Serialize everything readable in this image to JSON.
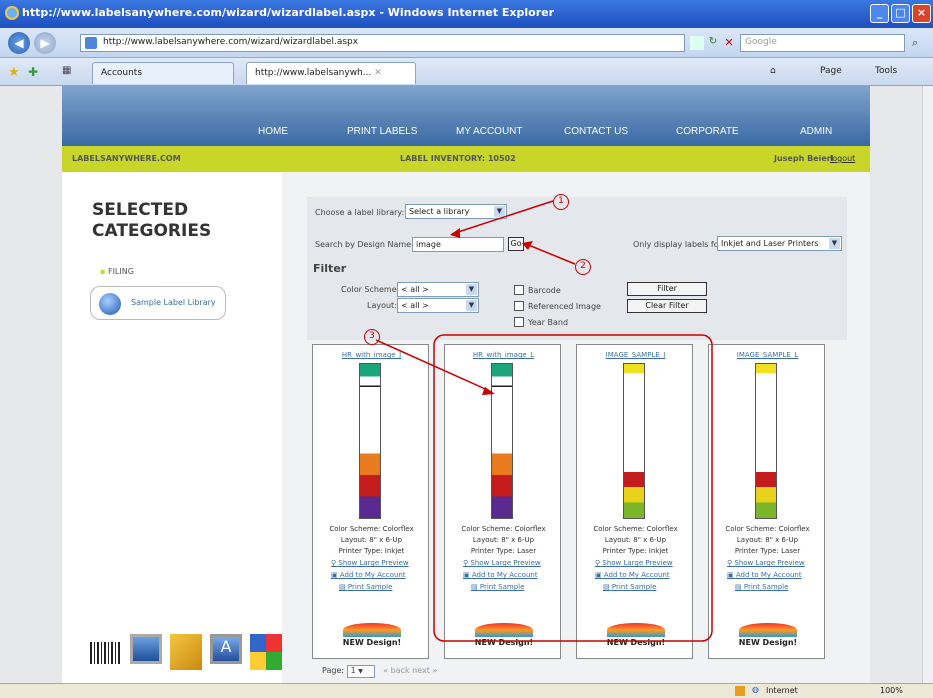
{
  "window": {
    "title": "http://www.labelsanywhere.com/wizard/wizardlabel.aspx - Windows Internet Explorer",
    "url": "http://www.labelsanywhere.com/wizard/wizardlabel.aspx",
    "search_placeholder": "Google"
  },
  "tabs": [
    {
      "label": "Accounts"
    },
    {
      "label": "http://www.labelsanywh..."
    }
  ],
  "toolbar": {
    "page_label": "Page",
    "tools_label": "Tools"
  },
  "site": {
    "nav": [
      "HOME",
      "PRINT LABELS",
      "MY ACCOUNT",
      "CONTACT US",
      "CORPORATE",
      "ADMIN"
    ],
    "brand": "LABELSANYWHERE.COM",
    "inventory": "LABEL INVENTORY: 10502",
    "user": "Juseph Beierl",
    "logout": "logout"
  },
  "sidebar": {
    "heading_line1": "SELECTED",
    "heading_line2": "CATEGORIES",
    "filing": "FILING",
    "library_button": "Sample Label Library"
  },
  "form": {
    "choose_label": "Choose a label library:",
    "choose_value": "Select a library",
    "search_label": "Search by Design Name:",
    "search_value": "image",
    "go_label": "Go",
    "only_display_label": "Only display labels for",
    "only_display_value": "Inkjet and Laser Printers",
    "filter_heading": "Filter",
    "color_scheme_label": "Color Scheme:",
    "color_scheme_value": "< all >",
    "layout_label": "Layout:",
    "layout_value": "< all >",
    "checkboxes": [
      "Barcode",
      "Referenced Image",
      "Year Band"
    ],
    "filter_button": "Filter",
    "clear_filter_button": "Clear Filter"
  },
  "callouts": [
    "1",
    "2",
    "3"
  ],
  "cards": [
    {
      "title": "HR_with_image_J",
      "scheme": "Color Scheme: Colorflex",
      "layout": "Layout: 8\" x 6-Up",
      "printer": "Printer Type: Inkjet",
      "preview": "Show Large Preview",
      "add": "Add to My Account",
      "print": "Print Sample",
      "badge": "NEW Design!"
    },
    {
      "title": "HR_with_image_L",
      "scheme": "Color Scheme: Colorflex",
      "layout": "Layout: 8\" x 6-Up",
      "printer": "Printer Type: Laser",
      "preview": "Show Large Preview",
      "add": "Add to My Account",
      "print": "Print Sample",
      "badge": "NEW Design!"
    },
    {
      "title": "IMAGE_SAMPLE_J",
      "scheme": "Color Scheme: Colorflex",
      "layout": "Layout: 8\" x 6-Up",
      "printer": "Printer Type: Inkjet",
      "preview": "Show Large Preview",
      "add": "Add to My Account",
      "print": "Print Sample",
      "badge": "NEW Design!"
    },
    {
      "title": "IMAGE_SAMPLE_L",
      "scheme": "Color Scheme: Colorflex",
      "layout": "Layout: 8\" x 6-Up",
      "printer": "Printer Type: Laser",
      "preview": "Show Large Preview",
      "add": "Add to My Account",
      "print": "Print Sample",
      "badge": "NEW Design!"
    }
  ],
  "pager": {
    "label": "Page:",
    "value": "1",
    "nav": "« back next »"
  },
  "status": {
    "zone": "Internet",
    "zoom": "100%"
  },
  "colors": {
    "green_bar": "#c8d62a",
    "header_blue": "#3a6aa4",
    "callout_red": "#cc0000"
  }
}
